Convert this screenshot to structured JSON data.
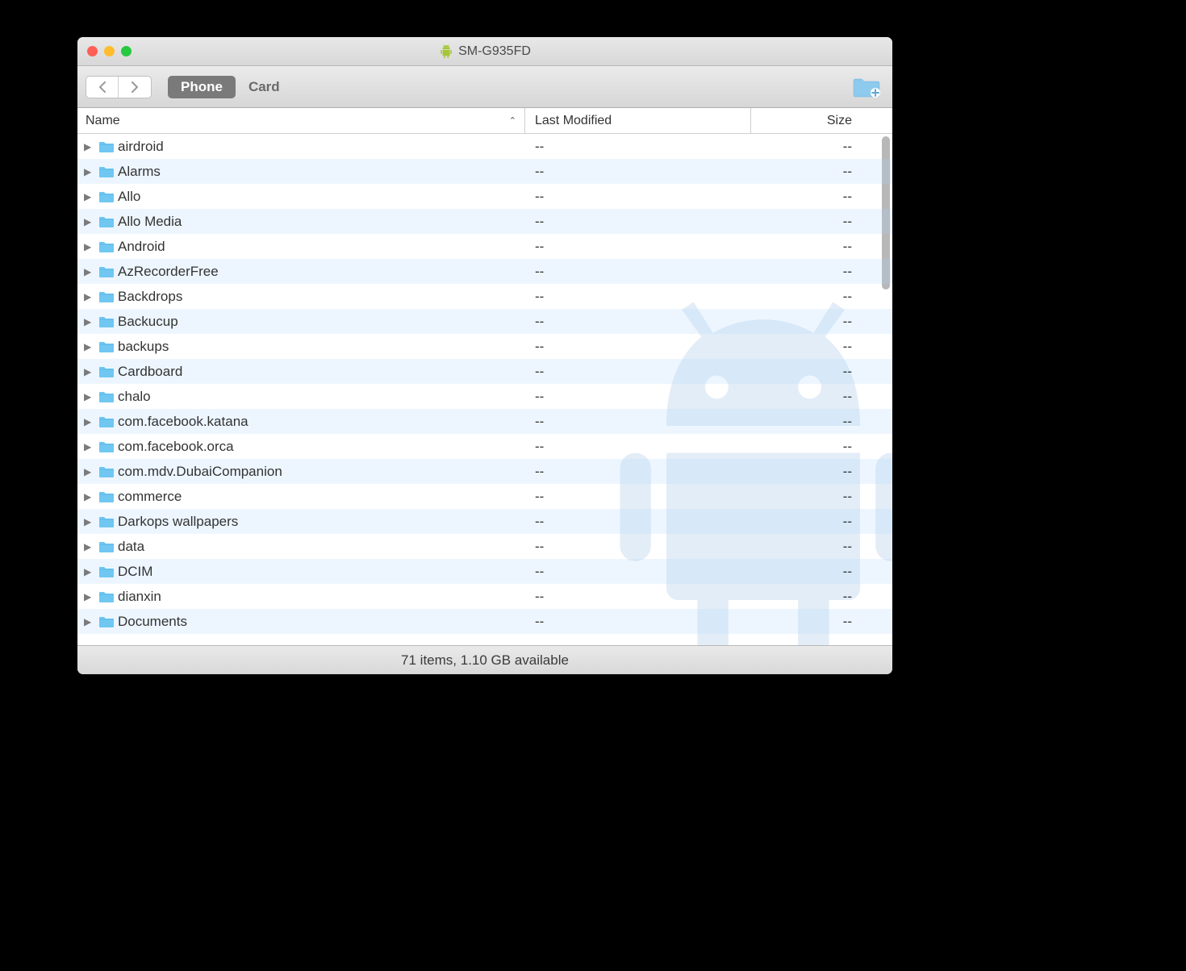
{
  "title": "SM-G935FD",
  "tabs": {
    "phone": "Phone",
    "card": "Card"
  },
  "columns": {
    "name": "Name",
    "last_modified": "Last Modified",
    "size": "Size"
  },
  "folders": [
    {
      "name": "airdroid",
      "modified": "--",
      "size": "--"
    },
    {
      "name": "Alarms",
      "modified": "--",
      "size": "--"
    },
    {
      "name": "Allo",
      "modified": "--",
      "size": "--"
    },
    {
      "name": "Allo Media",
      "modified": "--",
      "size": "--"
    },
    {
      "name": "Android",
      "modified": "--",
      "size": "--"
    },
    {
      "name": "AzRecorderFree",
      "modified": "--",
      "size": "--"
    },
    {
      "name": "Backdrops",
      "modified": "--",
      "size": "--"
    },
    {
      "name": "Backucup",
      "modified": "--",
      "size": "--"
    },
    {
      "name": "backups",
      "modified": "--",
      "size": "--"
    },
    {
      "name": "Cardboard",
      "modified": "--",
      "size": "--"
    },
    {
      "name": "chalo",
      "modified": "--",
      "size": "--"
    },
    {
      "name": "com.facebook.katana",
      "modified": "--",
      "size": "--"
    },
    {
      "name": "com.facebook.orca",
      "modified": "--",
      "size": "--"
    },
    {
      "name": "com.mdv.DubaiCompanion",
      "modified": "--",
      "size": "--"
    },
    {
      "name": "commerce",
      "modified": "--",
      "size": "--"
    },
    {
      "name": "Darkops wallpapers",
      "modified": "--",
      "size": "--"
    },
    {
      "name": "data",
      "modified": "--",
      "size": "--"
    },
    {
      "name": "DCIM",
      "modified": "--",
      "size": "--"
    },
    {
      "name": "dianxin",
      "modified": "--",
      "size": "--"
    },
    {
      "name": "Documents",
      "modified": "--",
      "size": "--"
    }
  ],
  "status": "71 items, 1.10 GB available"
}
